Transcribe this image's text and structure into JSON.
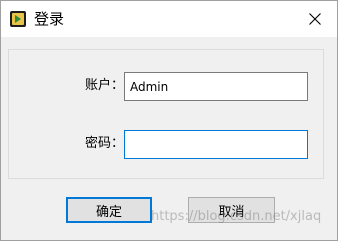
{
  "window": {
    "title": "登录",
    "close_icon": "close-icon",
    "app_icon": "application-icon"
  },
  "form": {
    "account_label": "账户：",
    "account_value": "Admin",
    "password_label": "密码：",
    "password_value": ""
  },
  "buttons": {
    "ok_label": "确定",
    "cancel_label": "取消"
  },
  "watermark": {
    "text": "https://blog.csdn.net/xjlaq"
  },
  "colors": {
    "accent": "#0078d7",
    "window_bg": "#f0f0f0",
    "titlebar_bg": "#ffffff"
  }
}
